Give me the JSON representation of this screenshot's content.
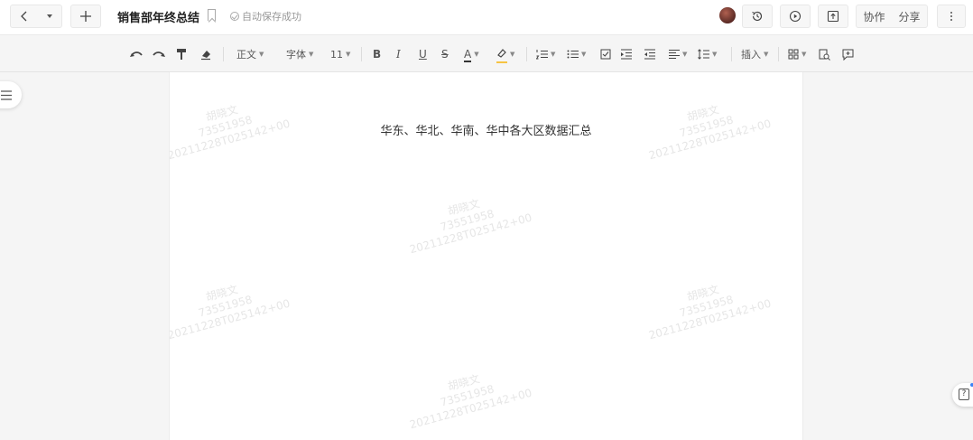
{
  "topbar": {
    "title": "销售部年终总结",
    "save_status": "自动保存成功",
    "collab_label": "协作",
    "share_label": "分享"
  },
  "toolbar": {
    "style_label": "正文",
    "font_label": "字体",
    "size_label": "11",
    "insert_label": "插入",
    "font_color": "#333333",
    "highlight_color": "#f6c343"
  },
  "document": {
    "heading": "华东、华北、华南、华中各大区数据汇总",
    "watermark": {
      "line1": "胡晓文",
      "line2": "73551958",
      "line3": "20211228T025142+00"
    }
  },
  "icons": [
    "back-arrow-icon",
    "caret-down-icon",
    "plus-icon",
    "bookmark-icon",
    "check-circle-icon",
    "history-icon",
    "play-icon",
    "present-icon",
    "more-icon",
    "undo-icon",
    "redo-icon",
    "format-painter-icon",
    "eraser-icon",
    "bold-icon",
    "italic-icon",
    "underline-icon",
    "strikethrough-icon",
    "font-color-icon",
    "highlight-icon",
    "ordered-list-icon",
    "bullet-list-icon",
    "checkbox-icon",
    "indent-icon",
    "outdent-icon",
    "align-icon",
    "line-height-icon",
    "table-icon",
    "find-replace-icon",
    "comment-icon",
    "outline-icon",
    "help-icon"
  ]
}
